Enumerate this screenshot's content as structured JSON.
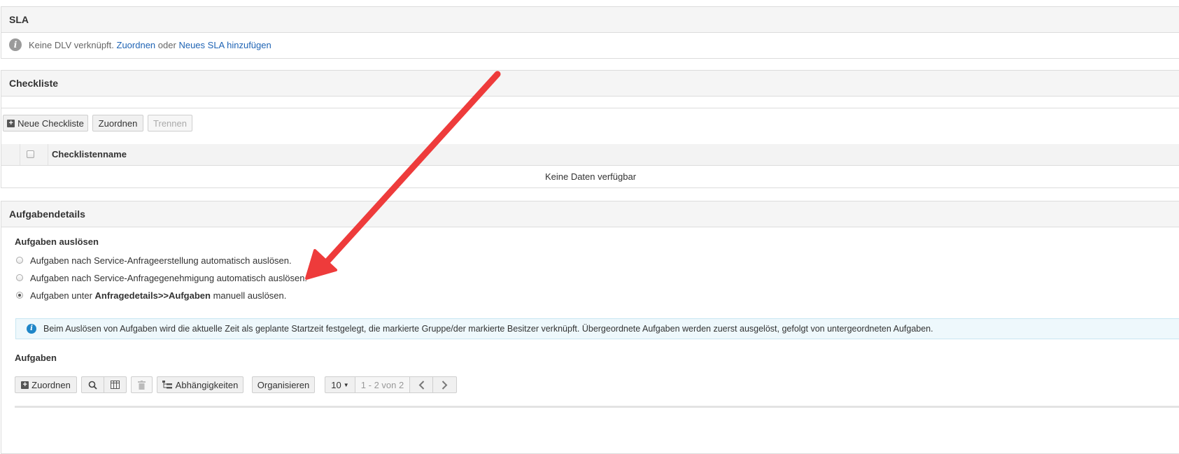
{
  "sla": {
    "title": "SLA",
    "message": "Keine DLV verknüpft.",
    "link_assign": "Zuordnen",
    "or_text": "oder",
    "link_new": "Neues SLA hinzufügen"
  },
  "checklist": {
    "title": "Checkliste",
    "btn_new": "Neue Checkliste",
    "btn_assign": "Zuordnen",
    "btn_detach": "Trennen",
    "col_name": "Checklistenname",
    "empty": "Keine Daten verfügbar"
  },
  "tasks": {
    "title": "Aufgabendetails",
    "trigger_label": "Aufgaben auslösen",
    "options": [
      {
        "text": "Aufgaben nach Service-Anfrageerstellung automatisch auslösen.",
        "selected": false
      },
      {
        "text": "Aufgaben nach Service-Anfragegenehmigung automatisch auslösen.",
        "selected": false
      },
      {
        "prefix": "Aufgaben unter ",
        "bold": "Anfragedetails>>Aufgaben",
        "suffix": " manuell auslösen.",
        "selected": true
      }
    ],
    "info": "Beim Auslösen von Aufgaben wird die aktuelle Zeit als geplante Startzeit festgelegt, die markierte Gruppe/der markierte Besitzer verknüpft. Übergeordnete Aufgaben werden zuerst ausgelöst, gefolgt von untergeordneten Aufgaben.",
    "list_label": "Aufgaben",
    "btn_assign": "Zuordnen",
    "btn_dependencies": "Abhängigkeiten",
    "btn_organize": "Organisieren",
    "page_size": "10",
    "page_range": "1 - 2 von 2"
  },
  "colors": {
    "link": "#1f64b5",
    "info_bg": "#eef8fc",
    "info_icon": "#1f86c8",
    "arrow": "#ee3b3b"
  }
}
